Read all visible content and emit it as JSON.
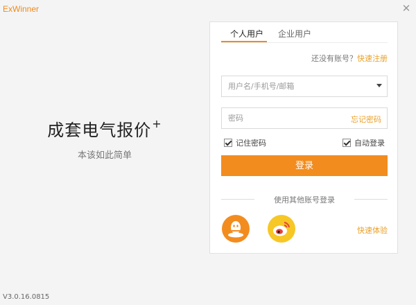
{
  "app": {
    "title": "ExWinner",
    "version": "V3.0.16.0815",
    "close_symbol": "✕"
  },
  "slogan": {
    "main": "成套电气报价",
    "plus": "+",
    "sub": "本该如此简单"
  },
  "tabs": [
    {
      "label": "个人用户",
      "active": true
    },
    {
      "label": "企业用户",
      "active": false
    }
  ],
  "register": {
    "prompt": "还没有账号？",
    "link": "快速注册"
  },
  "username": {
    "placeholder": "用户名/手机号/邮箱",
    "value": ""
  },
  "password": {
    "placeholder": "密码",
    "value": "",
    "forgot_label": "忘记密码"
  },
  "options": {
    "remember_label": "记住密码",
    "remember_checked": true,
    "auto_login_label": "自动登录",
    "auto_login_checked": true
  },
  "login_button": "登录",
  "other_login": {
    "label": "使用其他账号登录",
    "providers": [
      "qq-icon",
      "weibo-icon"
    ]
  },
  "quick_experience": "快速体验",
  "colors": {
    "accent": "#f28c1e",
    "link": "#e9a02a",
    "qq": "#f38c1f",
    "weibo": "#f7c726"
  }
}
